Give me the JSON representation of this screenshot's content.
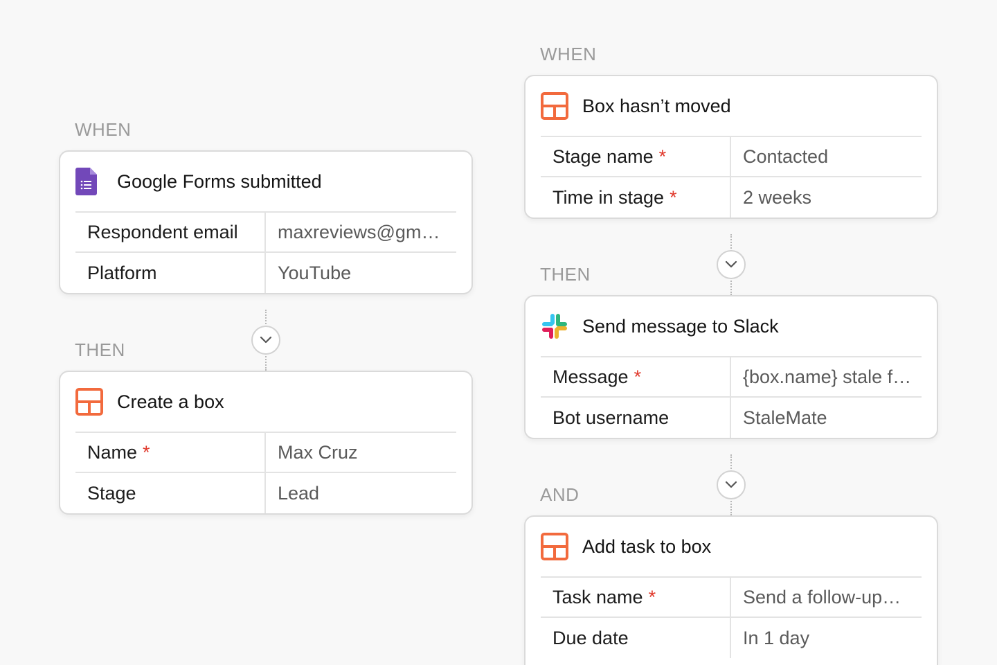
{
  "flows": [
    {
      "when_label": "WHEN",
      "trigger": {
        "icon": "google-forms-icon",
        "title": "Google Forms submitted",
        "fields": [
          {
            "key": "Respondent email",
            "required": false,
            "value": "maxreviews@gm…"
          },
          {
            "key": "Platform",
            "required": false,
            "value": "YouTube"
          }
        ]
      },
      "then_label": "THEN",
      "action": {
        "icon": "box-icon",
        "title": "Create a box",
        "fields": [
          {
            "key": "Name",
            "required": true,
            "value": "Max Cruz"
          },
          {
            "key": "Stage",
            "required": false,
            "value": "Lead"
          }
        ]
      }
    },
    {
      "when_label": "WHEN",
      "trigger": {
        "icon": "box-icon",
        "title": "Box hasn’t moved",
        "fields": [
          {
            "key": "Stage name",
            "required": true,
            "value": "Contacted"
          },
          {
            "key": "Time in stage",
            "required": true,
            "value": "2 weeks"
          }
        ]
      },
      "then_label": "THEN",
      "action": {
        "icon": "slack-icon",
        "title": "Send message to Slack",
        "fields": [
          {
            "key": "Message",
            "required": true,
            "value": "{box.name} stale f…"
          },
          {
            "key": "Bot username",
            "required": false,
            "value": "StaleMate"
          }
        ]
      },
      "and_label": "AND",
      "action2": {
        "icon": "box-icon",
        "title": "Add task to box",
        "fields": [
          {
            "key": "Task name",
            "required": true,
            "value": "Send a follow-up…"
          },
          {
            "key": "Due date",
            "required": false,
            "value": "In 1 day"
          }
        ]
      }
    }
  ],
  "required_mark": "*",
  "colors": {
    "required": "#e0382b",
    "box_icon": "#f26a3d",
    "forms_icon": "#7248b9"
  }
}
